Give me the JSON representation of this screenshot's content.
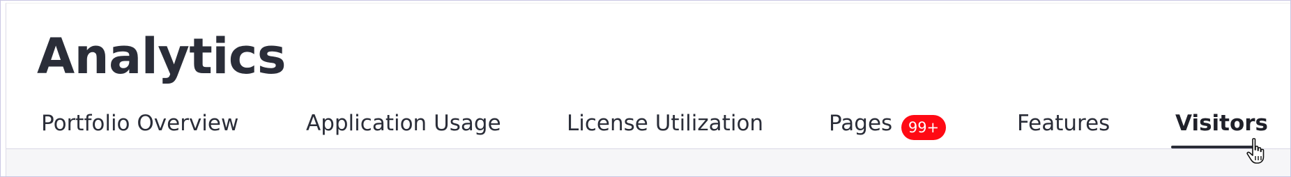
{
  "page": {
    "title": "Analytics"
  },
  "tabs": [
    {
      "label": "Portfolio Overview",
      "active": false
    },
    {
      "label": "Application Usage",
      "active": false
    },
    {
      "label": "License Utilization",
      "active": false
    },
    {
      "label": "Pages",
      "badge": "99+",
      "active": false
    },
    {
      "label": "Features",
      "active": false
    },
    {
      "label": "Visitors",
      "active": true
    }
  ],
  "colors": {
    "text": "#2a2d38",
    "badge_background": "#ff0a14",
    "badge_text": "#ffffff",
    "active_underline": "#2a2d38",
    "content_background": "#f6f6f8"
  },
  "icons": {
    "cursor": "hand-pointer-icon"
  }
}
